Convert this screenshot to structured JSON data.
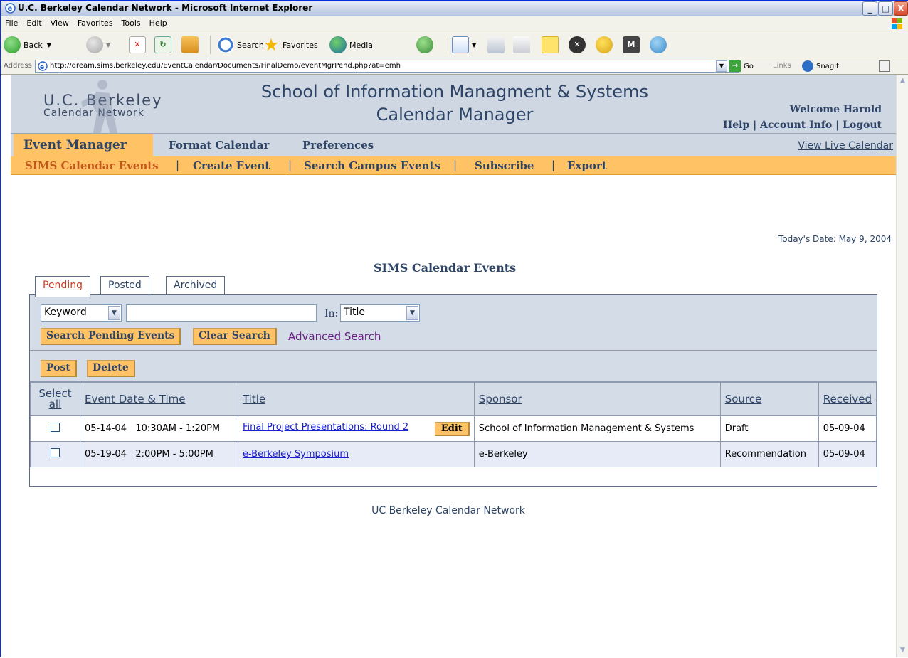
{
  "window": {
    "title": "U.C. Berkeley Calendar Network - Microsoft Internet Explorer",
    "minimize": "_",
    "maximize": "□",
    "close": "X"
  },
  "menu": [
    "File",
    "Edit",
    "View",
    "Favorites",
    "Tools",
    "Help"
  ],
  "toolbar": {
    "back": "Back",
    "search": "Search",
    "favorites": "Favorites",
    "media": "Media"
  },
  "address": {
    "label": "Address",
    "url": "http://dream.sims.berkeley.edu/EventCalendar/Documents/FinalDemo/eventMgrPend.php?at=emh",
    "go": "Go",
    "links": "Links",
    "snagit": "SnagIt"
  },
  "header": {
    "logo_line1": "U.C. Berkeley",
    "logo_line2": "Calendar Network",
    "title_line1": "School of Information Managment & Systems",
    "title_line2": "Calendar Manager",
    "welcome": "Welcome Harold",
    "help": "Help",
    "account": "Account Info",
    "logout": "Logout",
    "sep": "|"
  },
  "nav1": {
    "active": "Event Manager",
    "format": "Format Calendar",
    "preferences": "Preferences",
    "live": "View Live Calendar"
  },
  "nav2": {
    "items": [
      "SIMS Calendar Events",
      "Create Event",
      "Search Campus Events",
      "Subscribe",
      "Export"
    ],
    "sep": "|"
  },
  "today": "Today's Date: May 9, 2004",
  "section_title": "SIMS Calendar Events",
  "tabs": [
    "Pending",
    "Posted",
    "Archived"
  ],
  "search": {
    "field": "Keyword",
    "in_label": "In:",
    "in_value": "Title",
    "search_button": "Search Pending Events",
    "clear_button": "Clear Search",
    "advanced": "Advanced Search"
  },
  "actions": {
    "post": "Post",
    "delete": "Delete"
  },
  "table": {
    "headers": {
      "select": "Select",
      "select_all": "all",
      "date": "Event Date & Time",
      "title": "Title",
      "sponsor": "Sponsor",
      "source": "Source",
      "received": "Received"
    },
    "rows": [
      {
        "date": "05-14-04   10:30AM - 1:20PM",
        "title": "Final Project Presentations: Round 2",
        "edit": "Edit",
        "sponsor": "School of Information Management & Systems",
        "source": "Draft",
        "received": "05-09-04"
      },
      {
        "date": "05-19-04   2:00PM - 5:00PM",
        "title": "e-Berkeley Symposium",
        "sponsor": "e-Berkeley",
        "source": "Recommendation",
        "received": "05-09-04"
      }
    ]
  },
  "footer": "UC Berkeley Calendar Network"
}
